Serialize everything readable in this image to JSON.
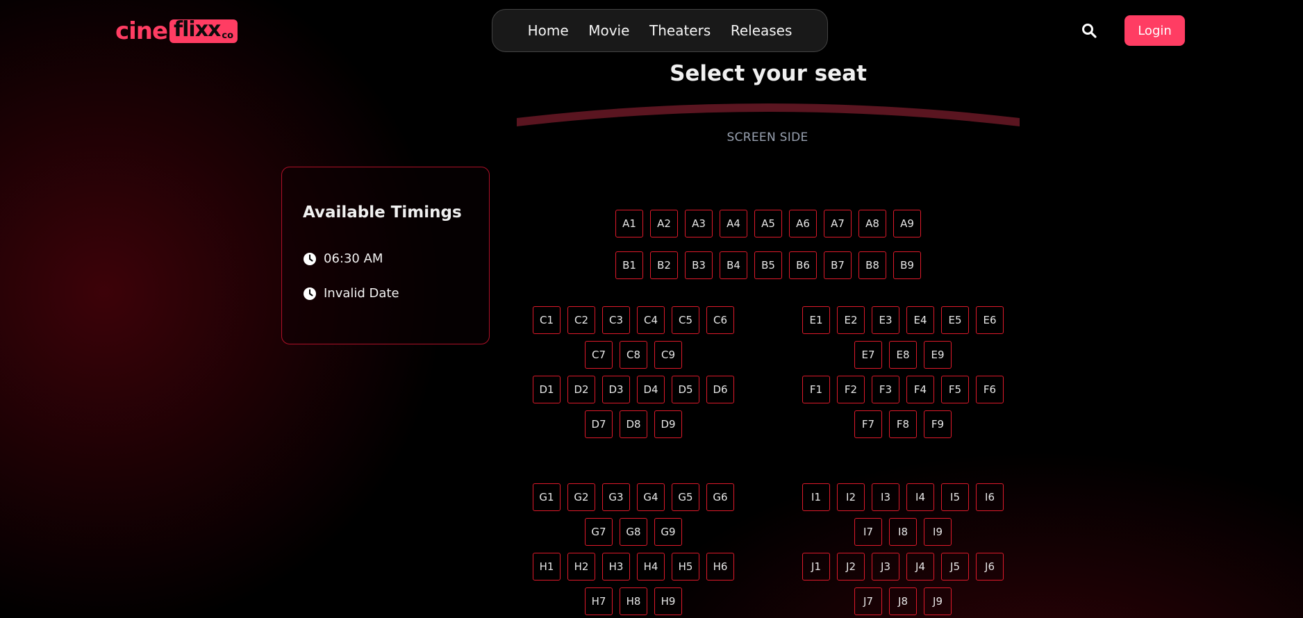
{
  "brand": {
    "part1": "cine",
    "part2": "flixx",
    "suffix": "co"
  },
  "nav": {
    "home": "Home",
    "movie": "Movie",
    "theaters": "Theaters",
    "releases": "Releases"
  },
  "header": {
    "login_label": "Login",
    "search_icon": "search-icon"
  },
  "page": {
    "title": "Select your seat",
    "screen_label": "SCREEN SIDE"
  },
  "timings": {
    "title": "Available Timings",
    "items": [
      "06:30 AM",
      "Invalid Date"
    ],
    "icon": "clock-icon"
  },
  "colors": {
    "accent": "#ff3d63",
    "seat_border": "#e01a2b",
    "panel_border": "#b01028",
    "screen_arc": "#5a1520"
  },
  "seats": {
    "A": [
      "A1",
      "A2",
      "A3",
      "A4",
      "A5",
      "A6",
      "A7",
      "A8",
      "A9"
    ],
    "B": [
      "B1",
      "B2",
      "B3",
      "B4",
      "B5",
      "B6",
      "B7",
      "B8",
      "B9"
    ],
    "C": [
      "C1",
      "C2",
      "C3",
      "C4",
      "C5",
      "C6",
      "C7",
      "C8",
      "C9"
    ],
    "D": [
      "D1",
      "D2",
      "D3",
      "D4",
      "D5",
      "D6",
      "D7",
      "D8",
      "D9"
    ],
    "E": [
      "E1",
      "E2",
      "E3",
      "E4",
      "E5",
      "E6",
      "E7",
      "E8",
      "E9"
    ],
    "F": [
      "F1",
      "F2",
      "F3",
      "F4",
      "F5",
      "F6",
      "F7",
      "F8",
      "F9"
    ],
    "G": [
      "G1",
      "G2",
      "G3",
      "G4",
      "G5",
      "G6",
      "G7",
      "G8",
      "G9"
    ],
    "H": [
      "H1",
      "H2",
      "H3",
      "H4",
      "H5",
      "H6",
      "H7",
      "H8",
      "H9"
    ],
    "I": [
      "I1",
      "I2",
      "I3",
      "I4",
      "I5",
      "I6",
      "I7",
      "I8",
      "I9"
    ],
    "J": [
      "J1",
      "J2",
      "J3",
      "J4",
      "J5",
      "J6",
      "J7",
      "J8",
      "J9"
    ]
  }
}
